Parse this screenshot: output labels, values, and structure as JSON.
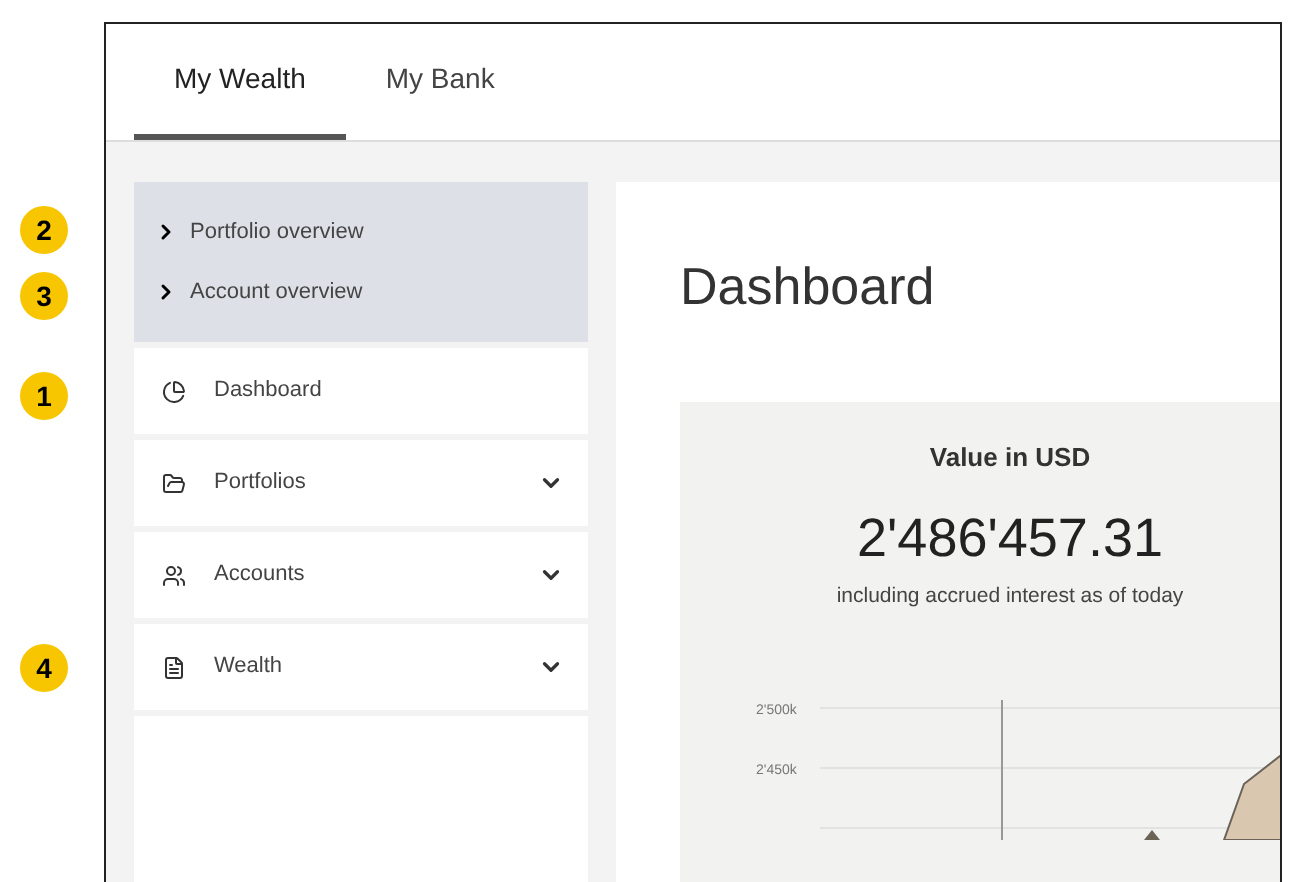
{
  "tabs": [
    {
      "label": "My Wealth",
      "selected": true
    },
    {
      "label": "My Bank",
      "selected": false
    }
  ],
  "quick_links": [
    "Portfolio overview",
    "Account overview"
  ],
  "nav_items": [
    {
      "label": "Dashboard",
      "kind": "pie",
      "expandable": false
    },
    {
      "label": "Portfolios",
      "kind": "folder",
      "expandable": true
    },
    {
      "label": "Accounts",
      "kind": "users",
      "expandable": true
    },
    {
      "label": "Wealth",
      "kind": "document",
      "expandable": true
    }
  ],
  "callouts": [
    "2",
    "3",
    "1",
    "4"
  ],
  "main": {
    "title": "Dashboard",
    "card": {
      "heading": "Value in USD",
      "value": "2'486'457.31",
      "caption": "including accrued interest as of today",
      "chart_tick_labels": [
        "2'500k",
        "2'450k"
      ]
    }
  }
}
